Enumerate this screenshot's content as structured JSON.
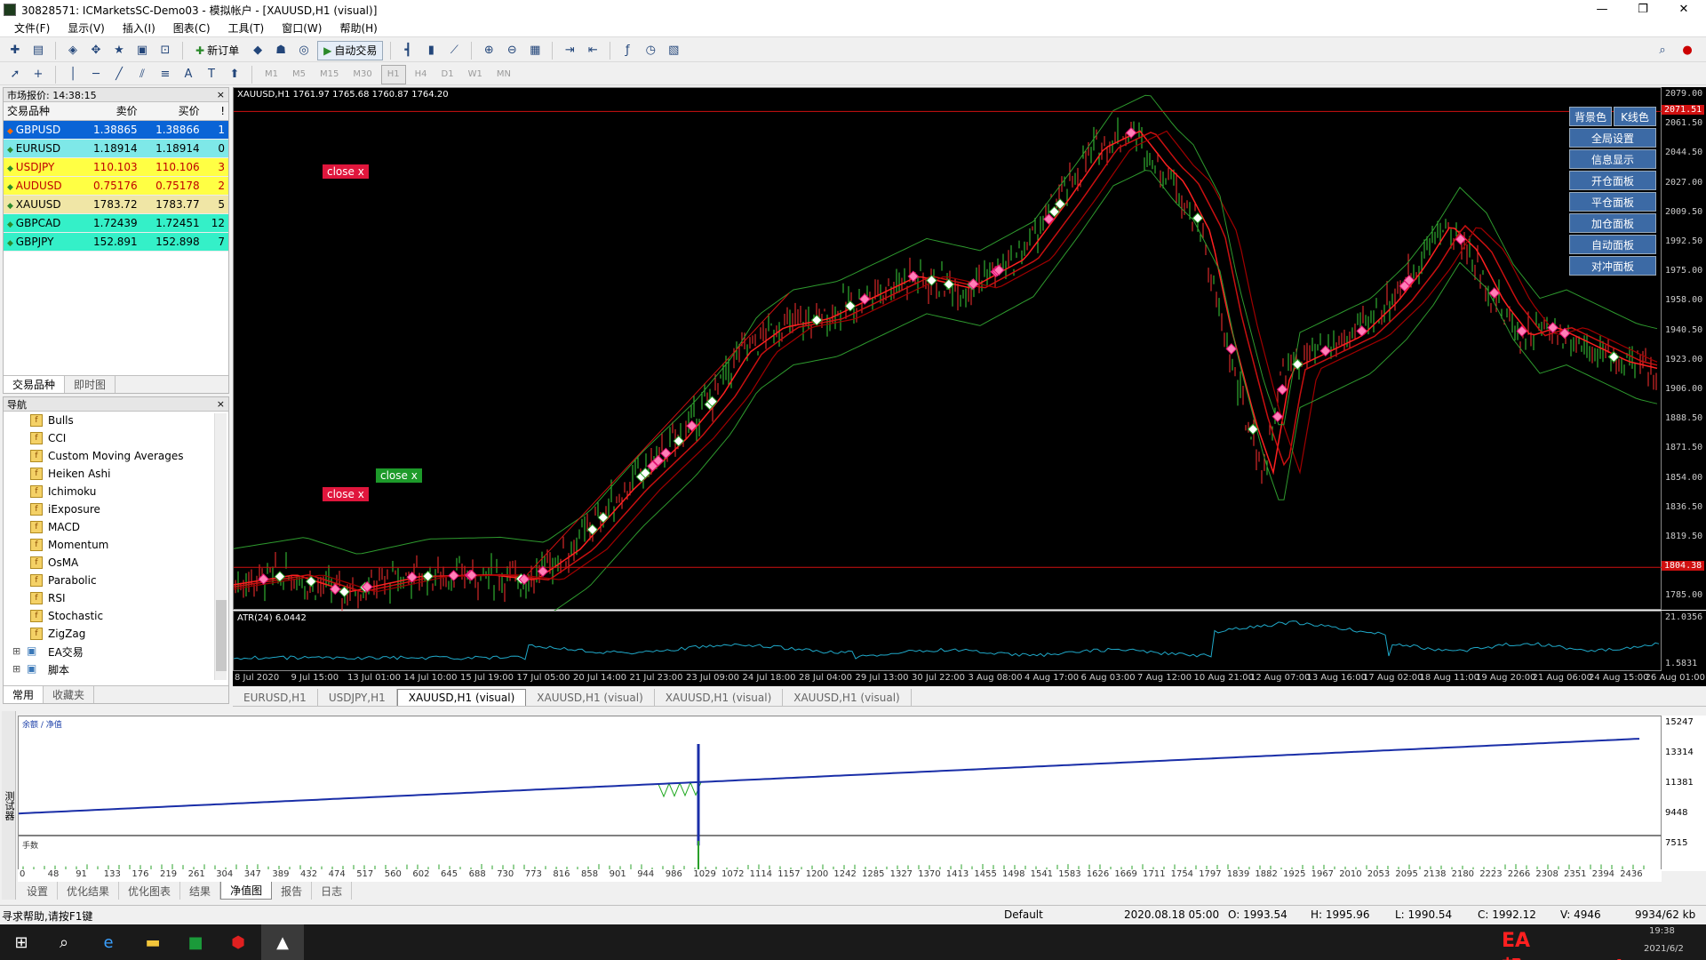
{
  "window": {
    "title": "30828571: ICMarketsSC-Demo03 - 模拟帐户 - [XAUUSD,H1 (visual)]",
    "minimize": "—",
    "restore": "❐",
    "close": "✕"
  },
  "menu": [
    "文件(F)",
    "显示(V)",
    "插入(I)",
    "图表(C)",
    "工具(T)",
    "窗口(W)",
    "帮助(H)"
  ],
  "toolbar": {
    "new_order": "新订单",
    "auto_trade": "自动交易",
    "timeframes": [
      "M1",
      "M5",
      "M15",
      "M30",
      "H1",
      "H4",
      "D1",
      "W1",
      "MN"
    ]
  },
  "market_watch": {
    "title": "市场报价: 14:38:15",
    "headers": [
      "交易品种",
      "卖价",
      "买价",
      "!"
    ],
    "rows": [
      {
        "symbol": "GBPUSD",
        "bid": "1.38865",
        "ask": "1.38866",
        "spread": "1",
        "bg": "#0a64d6",
        "fg": "#ffffff"
      },
      {
        "symbol": "EURUSD",
        "bid": "1.18914",
        "ask": "1.18914",
        "spread": "0",
        "bg": "#7ee8e8",
        "fg": "#000000"
      },
      {
        "symbol": "USDJPY",
        "bid": "110.103",
        "ask": "110.106",
        "spread": "3",
        "bg": "#ffff44",
        "fg": "#c00000"
      },
      {
        "symbol": "AUDUSD",
        "bid": "0.75176",
        "ask": "0.75178",
        "spread": "2",
        "bg": "#ffff44",
        "fg": "#c00000"
      },
      {
        "symbol": "XAUUSD",
        "bid": "1783.72",
        "ask": "1783.77",
        "spread": "5",
        "bg": "#f0e6a6",
        "fg": "#000000"
      },
      {
        "symbol": "GBPCAD",
        "bid": "1.72439",
        "ask": "1.72451",
        "spread": "12",
        "bg": "#34f0c8",
        "fg": "#000000"
      },
      {
        "symbol": "GBPJPY",
        "bid": "152.891",
        "ask": "152.898",
        "spread": "7",
        "bg": "#34f0c8",
        "fg": "#000000"
      }
    ],
    "tabs": [
      "交易品种",
      "即时图"
    ]
  },
  "navigator": {
    "title": "导航",
    "items": [
      "Bulls",
      "CCI",
      "Custom Moving Averages",
      "Heiken Ashi",
      "Ichimoku",
      "iExposure",
      "MACD",
      "Momentum",
      "OsMA",
      "Parabolic",
      "RSI",
      "Stochastic",
      "ZigZag"
    ],
    "groups": [
      "EA交易",
      "脚本"
    ],
    "tabs": [
      "常用",
      "收藏夹"
    ]
  },
  "chart": {
    "header": "XAUUSD,H1  1761.97 1765.68 1760.87 1764.20",
    "price_ticks": [
      "2079.00",
      "2061.50",
      "2044.50",
      "2027.00",
      "2009.50",
      "1992.50",
      "1975.00",
      "1958.00",
      "1940.50",
      "1923.00",
      "1906.00",
      "1888.50",
      "1871.50",
      "1854.00",
      "1836.50",
      "1819.50",
      "1802.00",
      "1785.00"
    ],
    "price_tag_top": "2071.51",
    "price_tag_bottom": "1804.38",
    "time_ticks": [
      "8 Jul 2020",
      "9 Jul 15:00",
      "13 Jul 01:00",
      "14 Jul 10:00",
      "15 Jul 19:00",
      "17 Jul 05:00",
      "20 Jul 14:00",
      "21 Jul 23:00",
      "23 Jul 09:00",
      "24 Jul 18:00",
      "28 Jul 04:00",
      "29 Jul 13:00",
      "30 Jul 22:00",
      "3 Aug 08:00",
      "4 Aug 17:00",
      "6 Aug 03:00",
      "7 Aug 12:00",
      "10 Aug 21:00",
      "12 Aug 07:00",
      "13 Aug 16:00",
      "17 Aug 02:00",
      "18 Aug 11:00",
      "19 Aug 20:00",
      "21 Aug 06:00",
      "24 Aug 15:00",
      "26 Aug 01:00"
    ],
    "close_labels": [
      "close x",
      "close x",
      "close x"
    ],
    "atr_label": "ATR(24) 6.0442",
    "atr_ticks": [
      "21.0356",
      "1.5831"
    ],
    "buttons": [
      "全局设置",
      "信息显示",
      "开仓面板",
      "平仓面板",
      "加仓面板",
      "自动面板",
      "对冲面板"
    ],
    "top_buttons": [
      "背景色",
      "K线色"
    ],
    "tabs": [
      "EURUSD,H1",
      "USDJPY,H1",
      "XAUUSD,H1 (visual)",
      "XAUUSD,H1 (visual)",
      "XAUUSD,H1 (visual)",
      "XAUUSD,H1 (visual)"
    ]
  },
  "equity": {
    "legend": "余额 / 净值",
    "vol_label": "手数",
    "y_ticks": [
      "15247",
      "13314",
      "11381",
      "9448",
      "7515"
    ],
    "x_ticks": [
      "0",
      "48",
      "91",
      "133",
      "176",
      "219",
      "261",
      "304",
      "347",
      "389",
      "432",
      "474",
      "517",
      "560",
      "602",
      "645",
      "688",
      "730",
      "773",
      "816",
      "858",
      "901",
      "944",
      "986",
      "1029",
      "1072",
      "1114",
      "1157",
      "1200",
      "1242",
      "1285",
      "1327",
      "1370",
      "1413",
      "1455",
      "1498",
      "1541",
      "1583",
      "1626",
      "1669",
      "1711",
      "1754",
      "1797",
      "1839",
      "1882",
      "1925",
      "1967",
      "2010",
      "2053",
      "2095",
      "2138",
      "2180",
      "2223",
      "2266",
      "2308",
      "2351",
      "2394",
      "2436"
    ],
    "tabs": [
      "设置",
      "优化结果",
      "优化图表",
      "结果",
      "净值图",
      "报告",
      "日志"
    ],
    "side_label": "测试器"
  },
  "status": {
    "help": "寻求帮助,请按F1键",
    "profile": "Default",
    "datetime": "2020.08.18 05:00",
    "open": "O: 1993.54",
    "high": "H: 1995.96",
    "low": "L: 1990.54",
    "close": "C: 1992.12",
    "volume": "V: 4946",
    "traffic": "9934/62 kb"
  },
  "taskbar": {
    "watermark": "EA邦:www.eabang.com",
    "time": "19:38",
    "date": "2021/6/2"
  }
}
